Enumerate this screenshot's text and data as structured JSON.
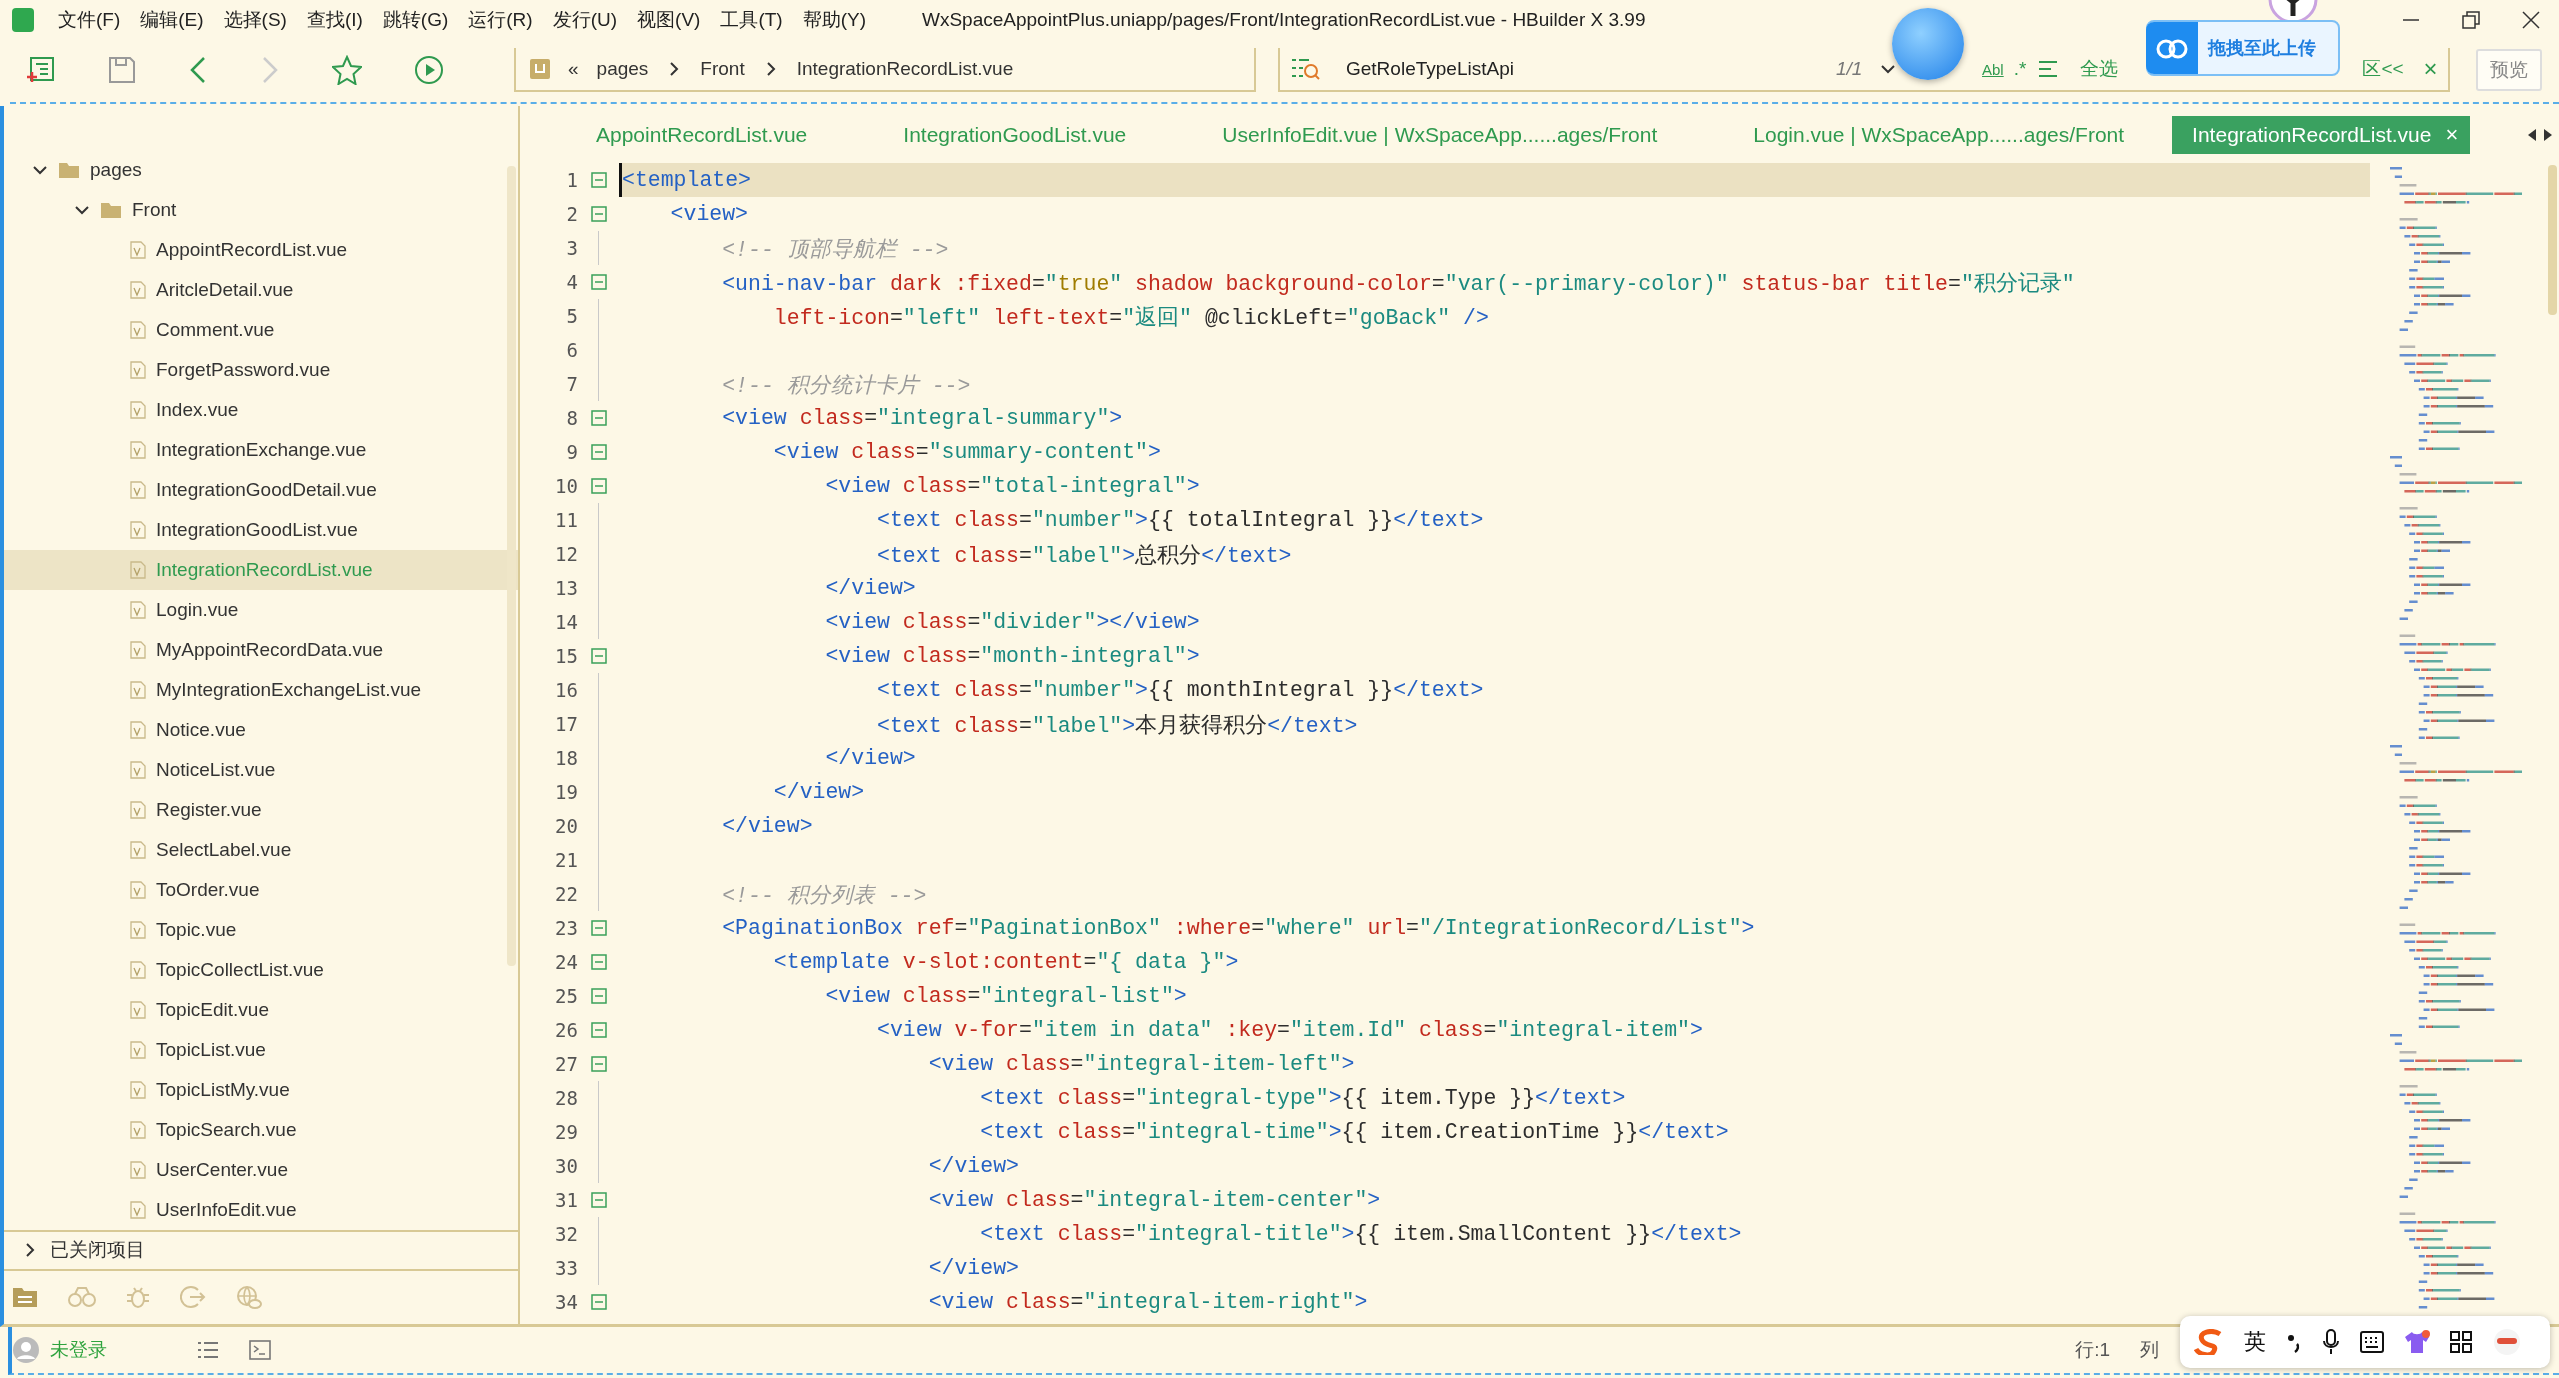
{
  "window": {
    "title": "WxSpaceAppointPlus.uniapp/pages/Front/IntegrationRecordList.vue - HBuilder X 3.99"
  },
  "menu": [
    "文件(F)",
    "编辑(E)",
    "选择(S)",
    "查找(I)",
    "跳转(G)",
    "运行(R)",
    "发行(U)",
    "视图(V)",
    "工具(T)",
    "帮助(Y)"
  ],
  "toolbar": {
    "breadcrumb": [
      "pages",
      "Front",
      "IntegrationRecordList.vue"
    ],
    "back_sign": "«",
    "find": {
      "value": "GetRoleTypeListApi",
      "count": "1/1",
      "whole_word": "Abl",
      "regex": ".*",
      "select_all": "全选",
      "replace_toggle": "区<<",
      "close": "×"
    },
    "preview": "预览"
  },
  "upload_widget": {
    "label": "拖拽至此上传"
  },
  "sidebar": {
    "tree": [
      {
        "label": "pages",
        "expanded": true,
        "children": [
          {
            "label": "Front",
            "expanded": true,
            "children": [
              {
                "label": "AppointRecordList.vue",
                "selected": false
              },
              {
                "label": "AritcleDetail.vue",
                "selected": false
              },
              {
                "label": "Comment.vue",
                "selected": false
              },
              {
                "label": "ForgetPassword.vue",
                "selected": false
              },
              {
                "label": "Index.vue",
                "selected": false
              },
              {
                "label": "IntegrationExchange.vue",
                "selected": false
              },
              {
                "label": "IntegrationGoodDetail.vue",
                "selected": false
              },
              {
                "label": "IntegrationGoodList.vue",
                "selected": false
              },
              {
                "label": "IntegrationRecordList.vue",
                "selected": true
              },
              {
                "label": "Login.vue",
                "selected": false
              },
              {
                "label": "MyAppointRecordData.vue",
                "selected": false
              },
              {
                "label": "MyIntegrationExchangeList.vue",
                "selected": false
              },
              {
                "label": "Notice.vue",
                "selected": false
              },
              {
                "label": "NoticeList.vue",
                "selected": false
              },
              {
                "label": "Register.vue",
                "selected": false
              },
              {
                "label": "SelectLabel.vue",
                "selected": false
              },
              {
                "label": "ToOrder.vue",
                "selected": false
              },
              {
                "label": "Topic.vue",
                "selected": false
              },
              {
                "label": "TopicCollectList.vue",
                "selected": false
              },
              {
                "label": "TopicEdit.vue",
                "selected": false
              },
              {
                "label": "TopicList.vue",
                "selected": false
              },
              {
                "label": "TopicListMy.vue",
                "selected": false
              },
              {
                "label": "TopicSearch.vue",
                "selected": false
              },
              {
                "label": "UserCenter.vue",
                "selected": false
              },
              {
                "label": "UserInfoEdit.vue",
                "selected": false
              }
            ]
          }
        ]
      }
    ],
    "closed_projects": {
      "label": "已关闭项目",
      "expanded": false
    }
  },
  "tabs": [
    {
      "label": "AppointRecordList.vue",
      "selected": false
    },
    {
      "label": "IntegrationGoodList.vue",
      "selected": false
    },
    {
      "label": "UserInfoEdit.vue | WxSpaceApp......ages/Front",
      "selected": false
    },
    {
      "label": "Login.vue | WxSpaceApp......ages/Front",
      "selected": false
    },
    {
      "label": "IntegrationRecordList.vue",
      "selected": true,
      "close": "×"
    }
  ],
  "editor": {
    "lines": [
      {
        "number": "1",
        "fold": true,
        "current": true,
        "tokens": [
          {
            "kind": "tag",
            "text": "<template>"
          }
        ]
      },
      {
        "number": "2",
        "fold": true,
        "current": false,
        "tokens": [
          {
            "kind": "tag",
            "text": "    <view>"
          }
        ]
      },
      {
        "number": "3",
        "fold": false,
        "current": false,
        "tokens": [
          {
            "kind": "comment",
            "text": "        <!-- 顶部导航栏 -->"
          }
        ]
      },
      {
        "number": "4",
        "fold": true,
        "current": false,
        "tokens": [
          {
            "kind": "tag",
            "text": "        <uni-nav-bar"
          },
          {
            "kind": "attr",
            "text": " dark :fixed"
          },
          {
            "kind": "text",
            "text": "="
          },
          {
            "kind": "str",
            "text": "\""
          },
          {
            "kind": "val",
            "text": "true"
          },
          {
            "kind": "str",
            "text": "\""
          },
          {
            "kind": "attr",
            "text": " shadow background-color"
          },
          {
            "kind": "text",
            "text": "="
          },
          {
            "kind": "str",
            "text": "\"var(--primary-color)\""
          },
          {
            "kind": "attr",
            "text": " status-bar title"
          },
          {
            "kind": "text",
            "text": "="
          },
          {
            "kind": "str",
            "text": "\"积分记录\""
          }
        ]
      },
      {
        "number": "5",
        "fold": false,
        "current": false,
        "tokens": [
          {
            "kind": "attr",
            "text": "            left-icon"
          },
          {
            "kind": "text",
            "text": "="
          },
          {
            "kind": "str",
            "text": "\"left\""
          },
          {
            "kind": "attr",
            "text": " left-text"
          },
          {
            "kind": "text",
            "text": "="
          },
          {
            "kind": "str",
            "text": "\"返回\""
          },
          {
            "kind": "text",
            "text": " @clickLeft="
          },
          {
            "kind": "str",
            "text": "\"goBack\""
          },
          {
            "kind": "tag",
            "text": " />"
          }
        ]
      },
      {
        "number": "6",
        "fold": false,
        "current": false
      },
      {
        "number": "7",
        "fold": false,
        "current": false,
        "tokens": [
          {
            "kind": "comment",
            "text": "        <!-- 积分统计卡片 -->"
          }
        ]
      },
      {
        "number": "8",
        "fold": true,
        "current": false,
        "tokens": [
          {
            "kind": "tag",
            "text": "        <view"
          },
          {
            "kind": "attr",
            "text": " class"
          },
          {
            "kind": "text",
            "text": "="
          },
          {
            "kind": "str",
            "text": "\"integral-summary\""
          },
          {
            "kind": "tag",
            "text": ">"
          }
        ]
      },
      {
        "number": "9",
        "fold": true,
        "current": false,
        "tokens": [
          {
            "kind": "tag",
            "text": "            <view"
          },
          {
            "kind": "attr",
            "text": " class"
          },
          {
            "kind": "text",
            "text": "="
          },
          {
            "kind": "str",
            "text": "\"summary-content\""
          },
          {
            "kind": "tag",
            "text": ">"
          }
        ]
      },
      {
        "number": "10",
        "fold": true,
        "current": false,
        "tokens": [
          {
            "kind": "tag",
            "text": "                <view"
          },
          {
            "kind": "attr",
            "text": " class"
          },
          {
            "kind": "text",
            "text": "="
          },
          {
            "kind": "str",
            "text": "\"total-integral\""
          },
          {
            "kind": "tag",
            "text": ">"
          }
        ]
      },
      {
        "number": "11",
        "fold": false,
        "current": false,
        "tokens": [
          {
            "kind": "tag",
            "text": "                    <text"
          },
          {
            "kind": "attr",
            "text": " class"
          },
          {
            "kind": "text",
            "text": "="
          },
          {
            "kind": "str",
            "text": "\"number\""
          },
          {
            "kind": "tag",
            "text": ">"
          },
          {
            "kind": "text",
            "text": "{{ totalIntegral }}"
          },
          {
            "kind": "tag",
            "text": "</text>"
          }
        ]
      },
      {
        "number": "12",
        "fold": false,
        "current": false,
        "tokens": [
          {
            "kind": "tag",
            "text": "                    <text"
          },
          {
            "kind": "attr",
            "text": " class"
          },
          {
            "kind": "text",
            "text": "="
          },
          {
            "kind": "str",
            "text": "\"label\""
          },
          {
            "kind": "tag",
            "text": ">"
          },
          {
            "kind": "text",
            "text": "总积分"
          },
          {
            "kind": "tag",
            "text": "</text>"
          }
        ]
      },
      {
        "number": "13",
        "fold": false,
        "current": false,
        "tokens": [
          {
            "kind": "tag",
            "text": "                </view>"
          }
        ]
      },
      {
        "number": "14",
        "fold": false,
        "current": false,
        "tokens": [
          {
            "kind": "tag",
            "text": "                <view"
          },
          {
            "kind": "attr",
            "text": " class"
          },
          {
            "kind": "text",
            "text": "="
          },
          {
            "kind": "str",
            "text": "\"divider\""
          },
          {
            "kind": "tag",
            "text": "></view>"
          }
        ]
      },
      {
        "number": "15",
        "fold": true,
        "current": false,
        "tokens": [
          {
            "kind": "tag",
            "text": "                <view"
          },
          {
            "kind": "attr",
            "text": " class"
          },
          {
            "kind": "text",
            "text": "="
          },
          {
            "kind": "str",
            "text": "\"month-integral\""
          },
          {
            "kind": "tag",
            "text": ">"
          }
        ]
      },
      {
        "number": "16",
        "fold": false,
        "current": false,
        "tokens": [
          {
            "kind": "tag",
            "text": "                    <text"
          },
          {
            "kind": "attr",
            "text": " class"
          },
          {
            "kind": "text",
            "text": "="
          },
          {
            "kind": "str",
            "text": "\"number\""
          },
          {
            "kind": "tag",
            "text": ">"
          },
          {
            "kind": "text",
            "text": "{{ monthIntegral }}"
          },
          {
            "kind": "tag",
            "text": "</text>"
          }
        ]
      },
      {
        "number": "17",
        "fold": false,
        "current": false,
        "tokens": [
          {
            "kind": "tag",
            "text": "                    <text"
          },
          {
            "kind": "attr",
            "text": " class"
          },
          {
            "kind": "text",
            "text": "="
          },
          {
            "kind": "str",
            "text": "\"label\""
          },
          {
            "kind": "tag",
            "text": ">"
          },
          {
            "kind": "text",
            "text": "本月获得积分"
          },
          {
            "kind": "tag",
            "text": "</text>"
          }
        ]
      },
      {
        "number": "18",
        "fold": false,
        "current": false,
        "tokens": [
          {
            "kind": "tag",
            "text": "                </view>"
          }
        ]
      },
      {
        "number": "19",
        "fold": false,
        "current": false,
        "tokens": [
          {
            "kind": "tag",
            "text": "            </view>"
          }
        ]
      },
      {
        "number": "20",
        "fold": false,
        "current": false,
        "tokens": [
          {
            "kind": "tag",
            "text": "        </view>"
          }
        ]
      },
      {
        "number": "21",
        "fold": false,
        "current": false
      },
      {
        "number": "22",
        "fold": false,
        "current": false,
        "tokens": [
          {
            "kind": "comment",
            "text": "        <!-- 积分列表 -->"
          }
        ]
      },
      {
        "number": "23",
        "fold": true,
        "current": false,
        "tokens": [
          {
            "kind": "tag",
            "text": "        <PaginationBox"
          },
          {
            "kind": "attr",
            "text": " ref"
          },
          {
            "kind": "text",
            "text": "="
          },
          {
            "kind": "str",
            "text": "\"PaginationBox\""
          },
          {
            "kind": "attr",
            "text": " :where"
          },
          {
            "kind": "text",
            "text": "="
          },
          {
            "kind": "str",
            "text": "\"where\""
          },
          {
            "kind": "attr",
            "text": " url"
          },
          {
            "kind": "text",
            "text": "="
          },
          {
            "kind": "str",
            "text": "\"/IntegrationRecord/List\""
          },
          {
            "kind": "tag",
            "text": ">"
          }
        ]
      },
      {
        "number": "24",
        "fold": true,
        "current": false,
        "tokens": [
          {
            "kind": "tag",
            "text": "            <template"
          },
          {
            "kind": "attr",
            "text": " v-slot:content"
          },
          {
            "kind": "text",
            "text": "="
          },
          {
            "kind": "str",
            "text": "\"{ data }\""
          },
          {
            "kind": "tag",
            "text": ">"
          }
        ]
      },
      {
        "number": "25",
        "fold": true,
        "current": false,
        "tokens": [
          {
            "kind": "tag",
            "text": "                <view"
          },
          {
            "kind": "attr",
            "text": " class"
          },
          {
            "kind": "text",
            "text": "="
          },
          {
            "kind": "str",
            "text": "\"integral-list\""
          },
          {
            "kind": "tag",
            "text": ">"
          }
        ]
      },
      {
        "number": "26",
        "fold": true,
        "current": false,
        "tokens": [
          {
            "kind": "tag",
            "text": "                    <view"
          },
          {
            "kind": "attr",
            "text": " v-for"
          },
          {
            "kind": "text",
            "text": "="
          },
          {
            "kind": "str",
            "text": "\"item in data\""
          },
          {
            "kind": "attr",
            "text": " :key"
          },
          {
            "kind": "text",
            "text": "="
          },
          {
            "kind": "str",
            "text": "\"item.Id\""
          },
          {
            "kind": "attr",
            "text": " class"
          },
          {
            "kind": "text",
            "text": "="
          },
          {
            "kind": "str",
            "text": "\"integral-item\""
          },
          {
            "kind": "tag",
            "text": ">"
          }
        ]
      },
      {
        "number": "27",
        "fold": true,
        "current": false,
        "tokens": [
          {
            "kind": "tag",
            "text": "                        <view"
          },
          {
            "kind": "attr",
            "text": " class"
          },
          {
            "kind": "text",
            "text": "="
          },
          {
            "kind": "str",
            "text": "\"integral-item-left\""
          },
          {
            "kind": "tag",
            "text": ">"
          }
        ]
      },
      {
        "number": "28",
        "fold": false,
        "current": false,
        "tokens": [
          {
            "kind": "tag",
            "text": "                            <text"
          },
          {
            "kind": "attr",
            "text": " class"
          },
          {
            "kind": "text",
            "text": "="
          },
          {
            "kind": "str",
            "text": "\"integral-type\""
          },
          {
            "kind": "tag",
            "text": ">"
          },
          {
            "kind": "text",
            "text": "{{ item.Type }}"
          },
          {
            "kind": "tag",
            "text": "</text>"
          }
        ]
      },
      {
        "number": "29",
        "fold": false,
        "current": false,
        "tokens": [
          {
            "kind": "tag",
            "text": "                            <text"
          },
          {
            "kind": "attr",
            "text": " class"
          },
          {
            "kind": "text",
            "text": "="
          },
          {
            "kind": "str",
            "text": "\"integral-time\""
          },
          {
            "kind": "tag",
            "text": ">"
          },
          {
            "kind": "text",
            "text": "{{ item.CreationTime }}"
          },
          {
            "kind": "tag",
            "text": "</text>"
          }
        ]
      },
      {
        "number": "30",
        "fold": false,
        "current": false,
        "tokens": [
          {
            "kind": "tag",
            "text": "                        </view>"
          }
        ]
      },
      {
        "number": "31",
        "fold": true,
        "current": false,
        "tokens": [
          {
            "kind": "tag",
            "text": "                        <view"
          },
          {
            "kind": "attr",
            "text": " class"
          },
          {
            "kind": "text",
            "text": "="
          },
          {
            "kind": "str",
            "text": "\"integral-item-center\""
          },
          {
            "kind": "tag",
            "text": ">"
          }
        ]
      },
      {
        "number": "32",
        "fold": false,
        "current": false,
        "tokens": [
          {
            "kind": "tag",
            "text": "                            <text"
          },
          {
            "kind": "attr",
            "text": " class"
          },
          {
            "kind": "text",
            "text": "="
          },
          {
            "kind": "str",
            "text": "\"integral-title\""
          },
          {
            "kind": "tag",
            "text": ">"
          },
          {
            "kind": "text",
            "text": "{{ item.SmallContent }}"
          },
          {
            "kind": "tag",
            "text": "</text>"
          }
        ]
      },
      {
        "number": "33",
        "fold": false,
        "current": false,
        "tokens": [
          {
            "kind": "tag",
            "text": "                        </view>"
          }
        ]
      },
      {
        "number": "34",
        "fold": true,
        "current": false,
        "tokens": [
          {
            "kind": "tag",
            "text": "                        <view"
          },
          {
            "kind": "attr",
            "text": " class"
          },
          {
            "kind": "text",
            "text": "="
          },
          {
            "kind": "str",
            "text": "\"integral-item-right\""
          },
          {
            "kind": "tag",
            "text": ">"
          }
        ]
      }
    ]
  },
  "status_bar": {
    "user": "未登录",
    "line": "行:1",
    "column": "列"
  },
  "ime_bar": {
    "language": "英"
  }
}
